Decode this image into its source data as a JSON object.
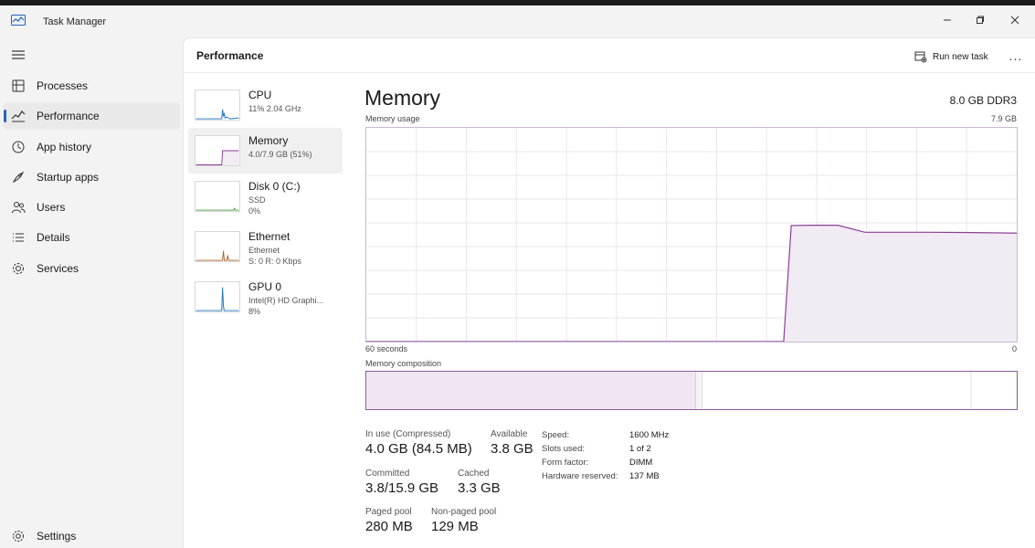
{
  "window": {
    "title": "Task Manager",
    "controls": {
      "minimize": "minimize-icon",
      "restore": "restore-icon",
      "close": "close-icon"
    }
  },
  "sidebar": {
    "menu_icon": "hamburger-icon",
    "items": [
      {
        "label": "Processes",
        "icon": "processes-icon",
        "active": false
      },
      {
        "label": "Performance",
        "icon": "performance-icon",
        "active": true
      },
      {
        "label": "App history",
        "icon": "app-history-icon",
        "active": false
      },
      {
        "label": "Startup apps",
        "icon": "startup-icon",
        "active": false
      },
      {
        "label": "Users",
        "icon": "users-icon",
        "active": false
      },
      {
        "label": "Details",
        "icon": "details-icon",
        "active": false
      },
      {
        "label": "Services",
        "icon": "services-icon",
        "active": false
      }
    ],
    "settings": {
      "label": "Settings",
      "icon": "gear-icon"
    },
    "accent": "#2a63b8"
  },
  "header": {
    "title": "Performance",
    "run_new_task": "Run new task",
    "more": "..."
  },
  "resources": [
    {
      "name": "CPU",
      "sub1": "11%  2.04 GHz",
      "sub2": "",
      "color": "#1f77c4",
      "active": false
    },
    {
      "name": "Memory",
      "sub1": "4.0/7.9 GB (51%)",
      "sub2": "",
      "color": "#8b3f96",
      "active": true
    },
    {
      "name": "Disk 0 (C:)",
      "sub1": "SSD",
      "sub2": "0%",
      "color": "#4a9a3c",
      "active": false
    },
    {
      "name": "Ethernet",
      "sub1": "Ethernet",
      "sub2": "S: 0  R: 0 Kbps",
      "color": "#b0602a",
      "active": false
    },
    {
      "name": "GPU 0",
      "sub1": "Intel(R) HD Graphi...",
      "sub2": "8%",
      "color": "#1f77c4",
      "active": false
    }
  ],
  "detail": {
    "title": "Memory",
    "spec": "8.0 GB DDR3",
    "usage_label": "Memory usage",
    "usage_max": "7.9 GB",
    "time_left": "60 seconds",
    "time_right": "0",
    "composition_label": "Memory composition",
    "accent": "#8b3f96",
    "fill": "#f1ebf3",
    "usage_fraction": 0.51
  },
  "chart_data": {
    "type": "area",
    "title": "Memory usage",
    "xlabel": "",
    "ylabel": "",
    "xlim": [
      60,
      0
    ],
    "ylim": [
      0,
      7.9
    ],
    "x": [
      60,
      21.5,
      20.8,
      19,
      16.5,
      14,
      8,
      4,
      0
    ],
    "values": [
      0,
      0,
      4.29,
      4.3,
      4.3,
      4.04,
      4.04,
      4.03,
      4.01
    ],
    "grid": true,
    "grid_vertical_lines": 13,
    "grid_horizontal_lines": 9,
    "composition_fractions": {
      "in_use": 0.507,
      "modified": 0.01,
      "standby": 0.413,
      "free": 0.07
    }
  },
  "stats": {
    "in_use_label": "In use (Compressed)",
    "in_use_value": "4.0 GB (84.5 MB)",
    "available_label": "Available",
    "available_value": "3.8 GB",
    "committed_label": "Committed",
    "committed_value": "3.8/15.9 GB",
    "cached_label": "Cached",
    "cached_value": "3.3 GB",
    "paged_label": "Paged pool",
    "paged_value": "280 MB",
    "nonpaged_label": "Non-paged pool",
    "nonpaged_value": "129 MB"
  },
  "specs": [
    {
      "k": "Speed:",
      "v": "1600 MHz"
    },
    {
      "k": "Slots used:",
      "v": "1 of 2"
    },
    {
      "k": "Form factor:",
      "v": "DIMM"
    },
    {
      "k": "Hardware reserved:",
      "v": "137 MB"
    }
  ]
}
